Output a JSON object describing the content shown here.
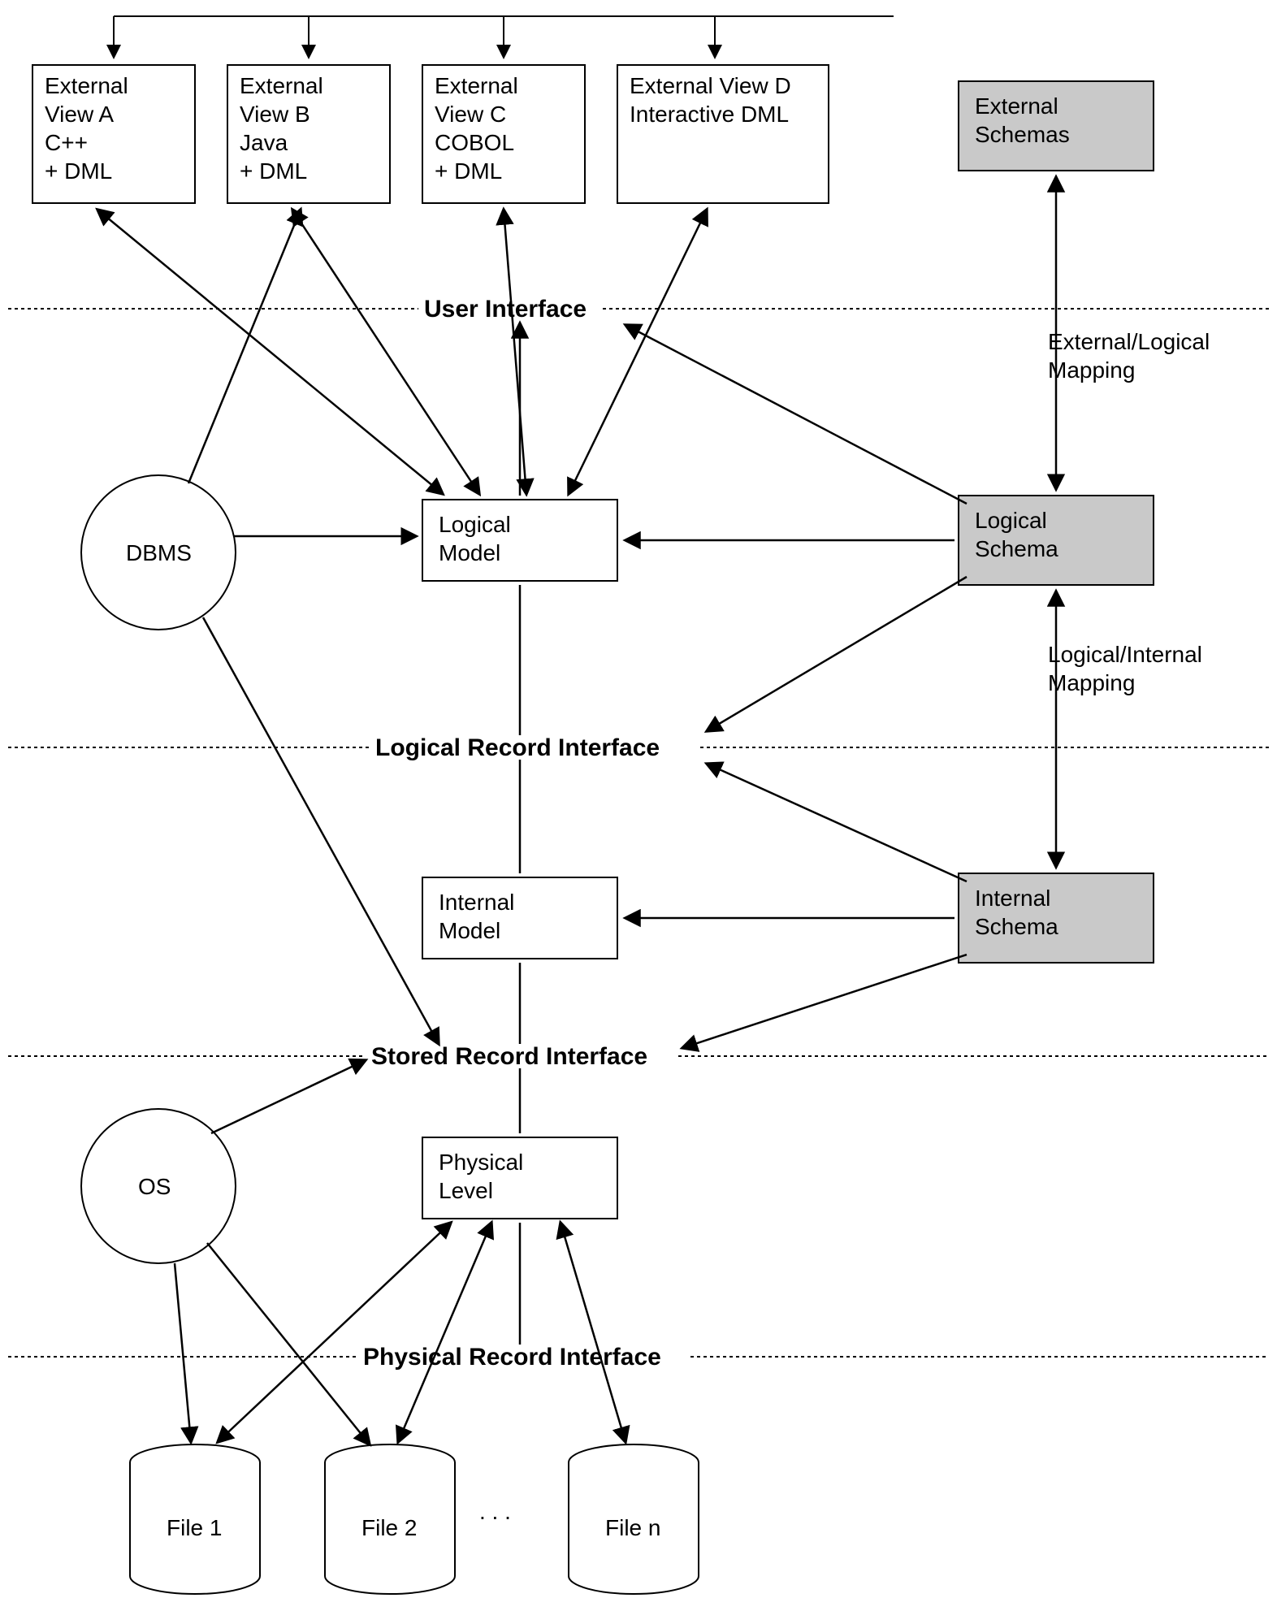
{
  "views": {
    "a": {
      "l1": "External",
      "l2": "View A",
      "l3": "C++",
      "l4": "+ DML"
    },
    "b": {
      "l1": "External",
      "l2": "View B",
      "l3": "Java",
      "l4": "+ DML"
    },
    "c": {
      "l1": "External",
      "l2": "View C",
      "l3": "COBOL",
      "l4": "+ DML"
    },
    "d": {
      "l1": "External View D",
      "l2": "Interactive DML"
    }
  },
  "schemas": {
    "external": {
      "l1": "External",
      "l2": "Schemas"
    },
    "logical": {
      "l1": "Logical",
      "l2": "Schema"
    },
    "internal": {
      "l1": "Internal",
      "l2": "Schema"
    }
  },
  "models": {
    "logical": {
      "l1": "Logical",
      "l2": "Model"
    },
    "internal": {
      "l1": "Internal",
      "l2": "Model"
    },
    "physical": {
      "l1": "Physical",
      "l2": "Level"
    }
  },
  "circles": {
    "dbms": "DBMS",
    "os": "OS"
  },
  "files": {
    "f1": "File 1",
    "f2": "File 2",
    "fn": "File n",
    "dots": ".  .  ."
  },
  "interfaces": {
    "ui": "User Interface",
    "lri": "Logical Record Interface",
    "sri": "Stored Record Interface",
    "pri": "Physical Record Interface"
  },
  "mappings": {
    "el1": "External/Logical",
    "el2": "Mapping",
    "li1": "Logical/Internal",
    "li2": "Mapping"
  }
}
